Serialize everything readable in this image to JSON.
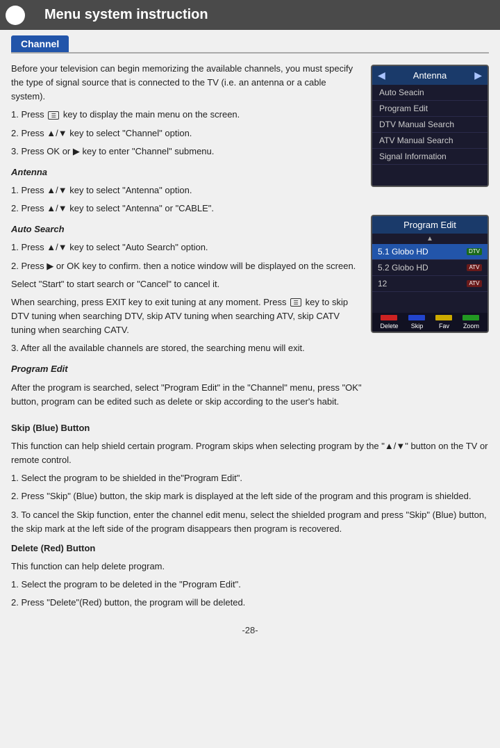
{
  "header": {
    "title": "Menu system instruction",
    "section": "Channel"
  },
  "intro_text": [
    "Before your television can begin memorizing the available channels, you must specify the type of signal source that is connected to the TV (i.e. an antenna or a cable system).",
    "1. Press  key to display the main menu on the screen.",
    "2. Press ▲/▼ key to select \"Channel\" option.",
    "3. Press OK or ▶ key to enter \"Channel\" submenu."
  ],
  "antenna_section": {
    "heading": "Antenna",
    "lines": [
      "1. Press ▲/▼ key to select \"Antenna\" option.",
      "2. Press  ▲/▼ key to select  \"Antenna\"  or \"CABLE\"."
    ]
  },
  "auto_search_section": {
    "heading": "Auto Search",
    "lines": [
      "1. Press ▲/▼ key to select \"Auto Search\" option.",
      "2. Press ▶ or OK key to confirm. then a notice window will be displayed on the screen.",
      "Select \"Start\" to start search or \"Cancel\" to cancel it.",
      "When searching, press EXIT key to exit tuning at any moment. Press  key to skip DTV tuning when searching DTV, skip ATV tuning when searching ATV, skip CATV tuning when searching CATV.",
      "3. After all the available channels are stored, the searching menu will exit."
    ]
  },
  "program_edit_section": {
    "heading": "Program Edit",
    "lines": [
      "After the program is searched, select \"Program Edit\" in the \"Channel\" menu, press \"OK\" button, program can be edited such as delete or skip according to the user's habit."
    ]
  },
  "tv_menu_widget": {
    "title": "Antenna",
    "items": [
      {
        "label": "Auto Seacin",
        "active": false
      },
      {
        "label": "Program Edit",
        "active": false
      },
      {
        "label": "DTV Manual Search",
        "active": false
      },
      {
        "label": "ATV Manual Search",
        "active": false
      },
      {
        "label": "Signal Information",
        "active": false
      }
    ]
  },
  "program_edit_widget": {
    "title": "Program Edit",
    "rows": [
      {
        "channel": "5.1 Globo HD",
        "badge": "DTV",
        "badge_type": "dtv",
        "selected": true
      },
      {
        "channel": "5.2 Globo HD",
        "badge": "ATV",
        "badge_type": "atv",
        "selected": false
      },
      {
        "channel": "12",
        "badge": "ATV",
        "badge_type": "atv",
        "selected": false
      }
    ],
    "footer_buttons": [
      {
        "label": "Delete",
        "color": "red"
      },
      {
        "label": "Skip",
        "color": "blue"
      },
      {
        "label": "Fav",
        "color": "yellow"
      },
      {
        "label": "Zoom",
        "color": "green"
      }
    ]
  },
  "skip_section": {
    "heading": "Skip (Blue) Button",
    "lines": [
      "This function can help shield certain program. Program skips when selecting program by the \"▲/▼\" button on the TV or remote control.",
      "1. Select the program to be shielded in the\"Program Edit\".",
      "2. Press \"Skip\" (Blue) button, the skip mark is displayed at the left side of the program and this program is shielded.",
      "3. To cancel the Skip function, enter the channel edit menu, select the shielded program and press \"Skip\" (Blue) button, the skip mark at the left side of the program disappears then program is recovered."
    ]
  },
  "delete_section": {
    "heading": "Delete (Red) Button",
    "lines": [
      "This function can help delete program.",
      "1. Select the program to be deleted in the \"Program Edit\".",
      "2. Press \"Delete\"(Red) button, the program will be deleted."
    ]
  },
  "footer": {
    "page_number": "-28-"
  }
}
